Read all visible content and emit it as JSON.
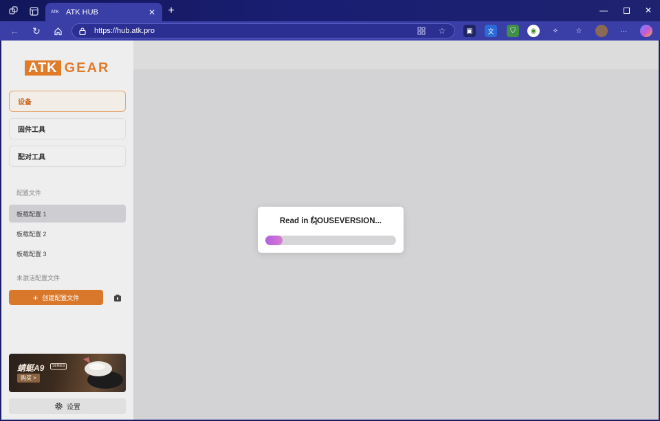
{
  "browser": {
    "tab_title": "ATK HUB",
    "tab_favicon": "ATK",
    "url": "https://hub.atk.pro"
  },
  "sidebar": {
    "logo_box": "ATK",
    "logo_text": "GEAR",
    "nav_items": [
      {
        "label": "设备"
      },
      {
        "label": "固件工具"
      },
      {
        "label": "配对工具"
      }
    ],
    "profiles_section_label": "配置文件",
    "onboard_profiles": [
      "板载配置 1",
      "板载配置 2",
      "板载配置 3"
    ],
    "inactive_section_label": "未激活配置文件",
    "create_button_label": "创建配置文件",
    "banner": {
      "title": "蜻蜓A9",
      "series": "SERIES",
      "buy_label": "购买 >"
    },
    "settings_label": "设置"
  },
  "modal": {
    "status_text": "Read in MOUSEVERSION...",
    "progress_fraction": 0.13
  },
  "colors": {
    "accent": "#d9782a",
    "browser_toolbar": "#3a3fa8",
    "progress": "#b15fe0"
  }
}
